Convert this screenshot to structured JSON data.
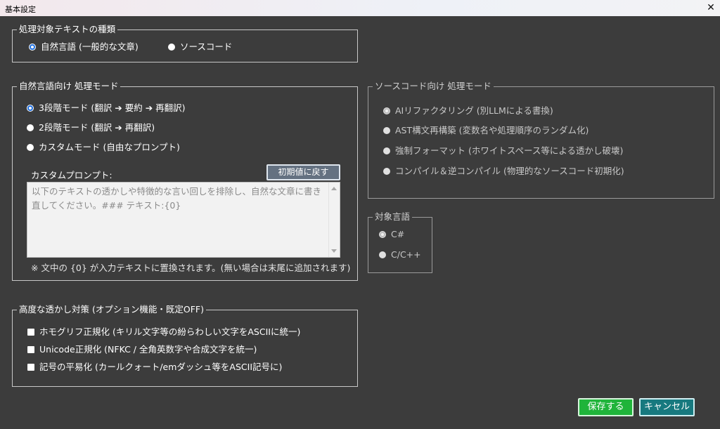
{
  "window": {
    "title": "基本設定",
    "close_glyph": "✕"
  },
  "target_type": {
    "legend": "処理対象テキストの種類",
    "options": [
      {
        "label": "自然言語 (一般的な文章)",
        "selected": true
      },
      {
        "label": "ソースコード",
        "selected": false
      }
    ]
  },
  "natural_mode": {
    "legend": "自然言語向け 処理モード",
    "options": [
      {
        "label": "3段階モード (翻訳 ➔ 要約 ➔ 再翻訳)",
        "selected": true
      },
      {
        "label": "2段階モード (翻訳 ➔ 再翻訳)",
        "selected": false
      },
      {
        "label": "カスタムモード (自由なプロンプト)",
        "selected": false
      }
    ],
    "custom_prompt_label": "カスタムプロンプト:",
    "reset_button_label": "初期値に戻す",
    "custom_prompt_value": "以下のテキストの透かしや特徴的な言い回しを排除し、自然な文章に書き直してください。### テキスト:{0}",
    "note": "※ 文中の {0} が入力テキストに置換されます。(無い場合は末尾に追加されます)"
  },
  "source_mode": {
    "legend": "ソースコード向け 処理モード",
    "enabled": false,
    "options": [
      {
        "label": "AIリファクタリング (別LLMによる書換)",
        "selected": true
      },
      {
        "label": "AST構文再構築 (変数名や処理順序のランダム化)",
        "selected": false
      },
      {
        "label": "強制フォーマット (ホワイトスペース等による透かし破壊)",
        "selected": false
      },
      {
        "label": "コンパイル＆逆コンパイル (物理的なソースコード初期化)",
        "selected": false
      }
    ]
  },
  "target_language": {
    "legend": "対象言語",
    "enabled": false,
    "options": [
      {
        "label": "C#",
        "selected": true
      },
      {
        "label": "C/C++",
        "selected": false
      }
    ]
  },
  "advanced": {
    "legend": "高度な透かし対策 (オプション機能・既定OFF)",
    "options": [
      {
        "label": "ホモグリフ正規化 (キリル文字等の紛らわしい文字をASCIIに統一)",
        "checked": false
      },
      {
        "label": "Unicode正規化 (NFKC / 全角英数字や合成文字を統一)",
        "checked": false
      },
      {
        "label": "記号の平易化 (カールクォート/emダッシュ等をASCII記号に)",
        "checked": false
      }
    ]
  },
  "footer": {
    "save_label": "保存する",
    "cancel_label": "キャンセル"
  },
  "colors": {
    "background": "#3c3c3c",
    "save_button": "#1fb43a",
    "cancel_button": "#17797f",
    "radio_selected": "#1e6fe0",
    "reset_button": "#647181"
  }
}
